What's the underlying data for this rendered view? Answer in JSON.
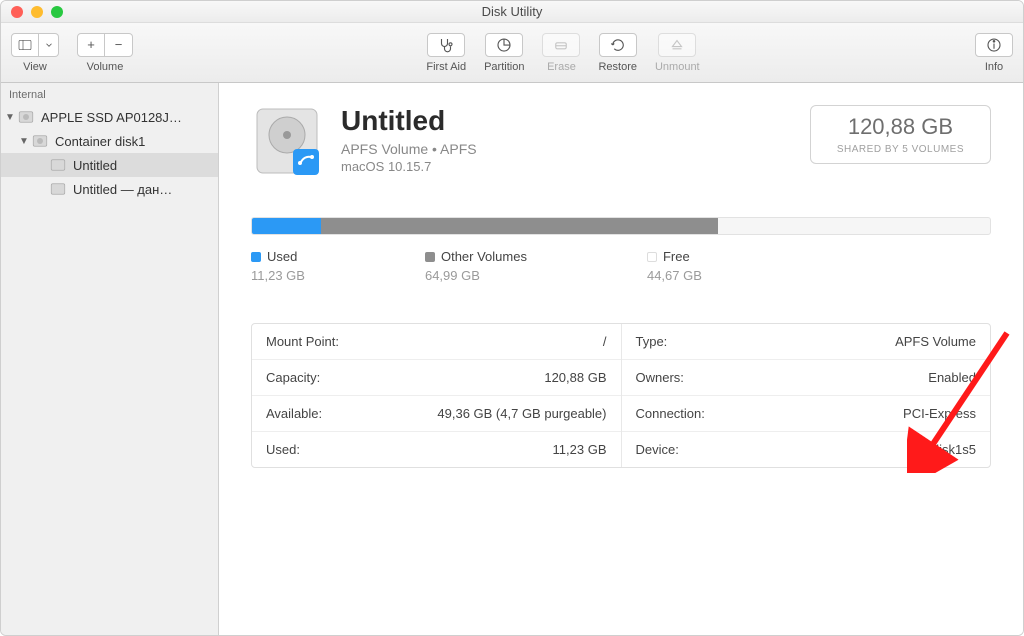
{
  "window": {
    "title": "Disk Utility"
  },
  "toolbar": {
    "view": "View",
    "volume": "Volume",
    "firstaid": "First Aid",
    "partition": "Partition",
    "erase": "Erase",
    "restore": "Restore",
    "unmount": "Unmount",
    "info": "Info"
  },
  "sidebar": {
    "header": "Internal",
    "items": [
      {
        "label": "APPLE SSD AP0128J…",
        "depth": 0,
        "expanded": true,
        "icon": "disk"
      },
      {
        "label": "Container disk1",
        "depth": 1,
        "expanded": true,
        "icon": "disk"
      },
      {
        "label": "Untitled",
        "depth": 2,
        "selected": true,
        "icon": "vol"
      },
      {
        "label": "Untitled — дан…",
        "depth": 2,
        "icon": "vol"
      }
    ]
  },
  "volume": {
    "name": "Untitled",
    "subtitle": "APFS Volume • APFS",
    "os": "macOS 10.15.7",
    "capacity_box": {
      "size": "120,88 GB",
      "subtitle": "SHARED BY 5 VOLUMES"
    }
  },
  "usage": {
    "used": {
      "label": "Used",
      "value": "11,23 GB",
      "color": "#2b99f5",
      "pct": 9.3
    },
    "other": {
      "label": "Other Volumes",
      "value": "64,99 GB",
      "color": "#8e8e8e",
      "pct": 53.8
    },
    "free": {
      "label": "Free",
      "value": "44,67 GB",
      "color": "#ffffff"
    }
  },
  "details_left": [
    {
      "k": "Mount Point:",
      "v": "/"
    },
    {
      "k": "Capacity:",
      "v": "120,88 GB"
    },
    {
      "k": "Available:",
      "v": "49,36 GB (4,7 GB purgeable)"
    },
    {
      "k": "Used:",
      "v": "11,23 GB"
    }
  ],
  "details_right": [
    {
      "k": "Type:",
      "v": "APFS Volume"
    },
    {
      "k": "Owners:",
      "v": "Enabled"
    },
    {
      "k": "Connection:",
      "v": "PCI-Express"
    },
    {
      "k": "Device:",
      "v": "disk1s5"
    }
  ]
}
